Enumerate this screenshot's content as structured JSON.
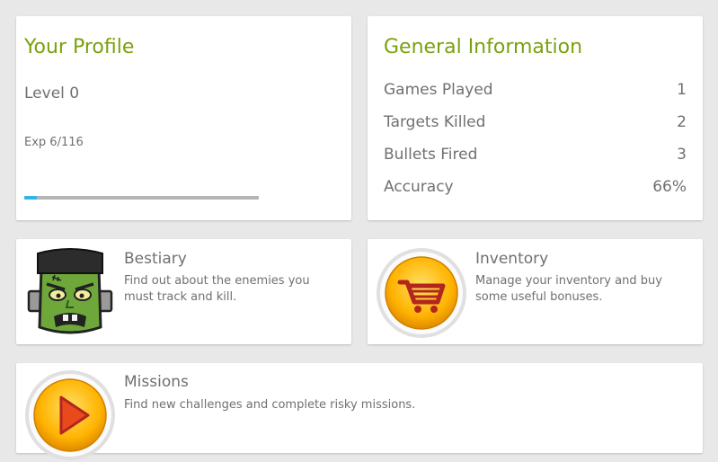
{
  "profile": {
    "title": "Your Profile",
    "level": "Level 0",
    "exp": "Exp 6/116",
    "exp_progress": 0.052
  },
  "info": {
    "title": "General Information",
    "stats": [
      {
        "label": "Games Played",
        "value": "1"
      },
      {
        "label": "Targets Killed",
        "value": "2"
      },
      {
        "label": "Bullets Fired",
        "value": "3"
      },
      {
        "label": "Accuracy",
        "value": "66%"
      }
    ]
  },
  "menu": {
    "bestiary": {
      "title": "Bestiary",
      "desc": "Find out about the enemies you must track and kill.",
      "icon": "monster-icon"
    },
    "inventory": {
      "title": "Inventory",
      "desc": "Manage your inventory and buy some useful bonuses.",
      "icon": "shopping-cart-icon"
    },
    "missions": {
      "title": "Missions",
      "desc": "Find new challenges and complete risky missions.",
      "icon": "play-icon"
    }
  },
  "colors": {
    "accent_green": "#7aa10e",
    "progress_blue": "#33b5e5",
    "background": "#e8e8e8",
    "card": "#ffffff",
    "text": "#707070"
  }
}
